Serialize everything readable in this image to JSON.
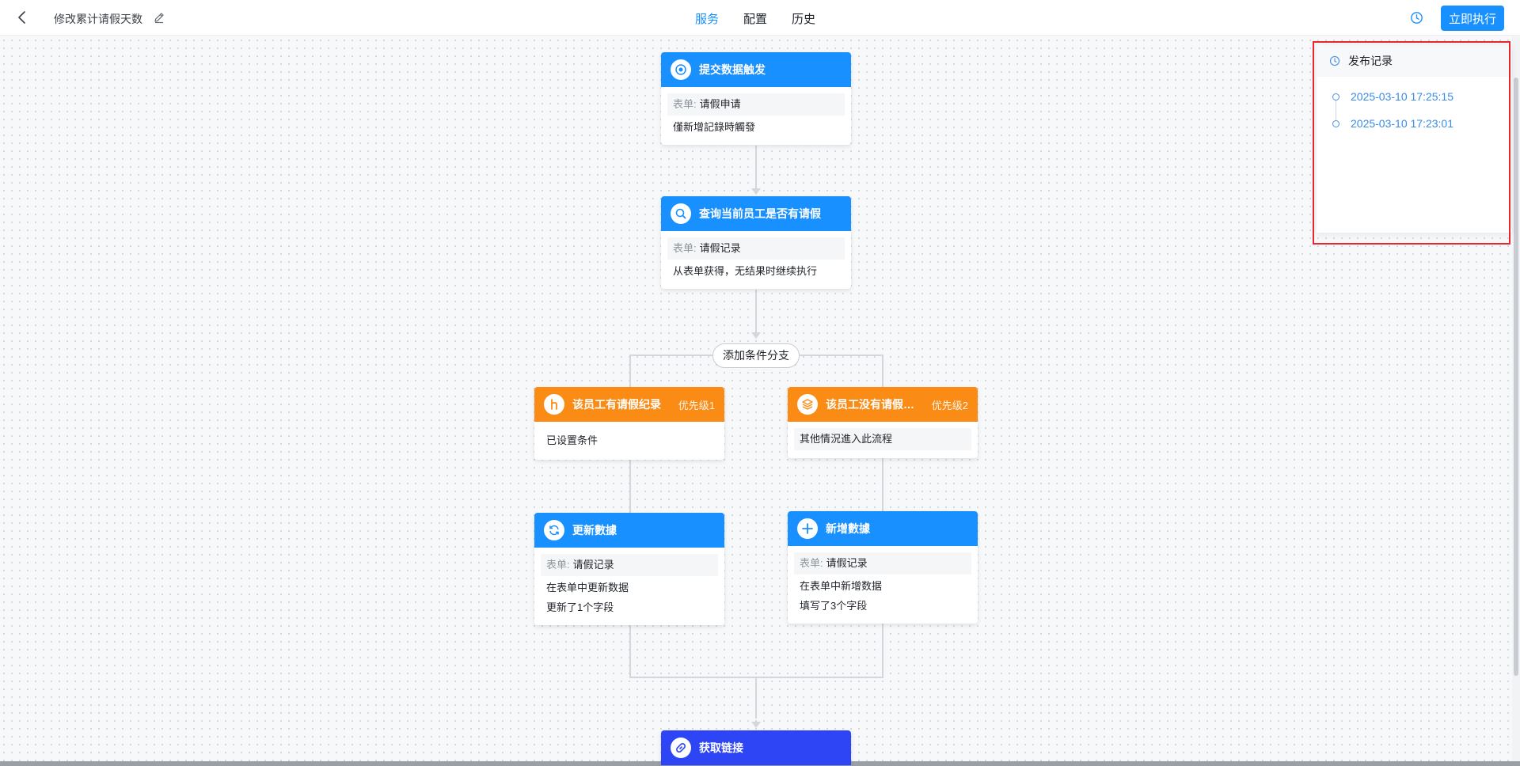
{
  "header": {
    "title": "修改累计请假天数",
    "tabs": [
      {
        "label": "服务",
        "active": true
      },
      {
        "label": "配置",
        "active": false
      },
      {
        "label": "历史",
        "active": false
      }
    ],
    "run_button": "立即执行"
  },
  "flow": {
    "trigger": {
      "title": "提交数据触发",
      "form_label": "表单:",
      "form_value": "请假申请",
      "desc": "僅新增記錄時觸發",
      "icon": "target-icon"
    },
    "query": {
      "title": "查询当前员工是否有请假",
      "form_label": "表单:",
      "form_value": "请假记录",
      "desc": "从表单获得，无结果时继续执行",
      "icon": "search-icon"
    },
    "add_branch": "添加条件分支",
    "branch_left": {
      "title": "该员工有请假纪录",
      "priority": "优先级1",
      "desc": "已设置条件",
      "icon": "branch-icon"
    },
    "branch_right": {
      "title": "该员工没有请假…",
      "priority": "优先级2",
      "desc": "其他情況進入此流程",
      "icon": "layers-icon"
    },
    "update": {
      "title": "更新數據",
      "form_label": "表单:",
      "form_value": "请假记录",
      "desc1": "在表单中更新数据",
      "desc2": "更新了1个字段",
      "icon": "refresh-icon"
    },
    "create": {
      "title": "新增數據",
      "form_label": "表单:",
      "form_value": "请假记录",
      "desc1": "在表单中新增数据",
      "desc2": "填写了3个字段",
      "icon": "plus-icon"
    },
    "link": {
      "title": "获取链接",
      "icon": "link-icon"
    }
  },
  "publish_panel": {
    "title": "发布记录",
    "records": [
      "2025-03-10 17:25:15",
      "2025-03-10 17:23:01"
    ]
  },
  "colors": {
    "primary": "#1890ff",
    "orange": "#fa8c16",
    "indigo": "#2d45f5",
    "highlight": "#e8262b"
  }
}
